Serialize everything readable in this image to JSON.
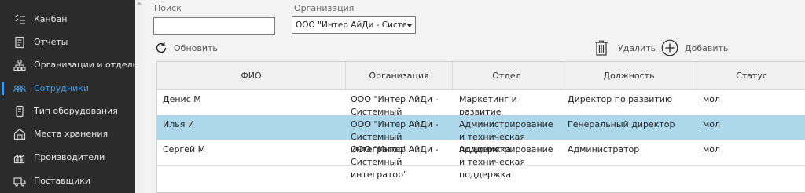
{
  "sidebar": {
    "items": [
      {
        "label": "Канбан",
        "icon": "kanban-icon",
        "active": false
      },
      {
        "label": "Отчеты",
        "icon": "reports-icon",
        "active": false
      },
      {
        "label": "Организации и отделы",
        "icon": "org-structure-icon",
        "active": false
      },
      {
        "label": "Сотрудники",
        "icon": "employees-icon",
        "active": true
      },
      {
        "label": "Тип оборудования",
        "icon": "equipment-type-icon",
        "active": false
      },
      {
        "label": "Места хранения",
        "icon": "storage-icon",
        "active": false
      },
      {
        "label": "Производители",
        "icon": "manufacturers-icon",
        "active": false
      },
      {
        "label": "Поставщики",
        "icon": "suppliers-icon",
        "active": false
      }
    ],
    "accent_color": "#3d9be9"
  },
  "filters": {
    "search_label": "Поиск",
    "search_value": "",
    "org_label": "Организация",
    "org_selected": "ООО \"Интер АйДи - Системный интегратор\""
  },
  "toolbar": {
    "refresh_label": "Обновить",
    "delete_label": "Удалить",
    "add_label": "Добавить"
  },
  "grid": {
    "columns": [
      "ФИО",
      "Организация",
      "Отдел",
      "Должность",
      "Статус"
    ],
    "rows": [
      {
        "fio": "Денис М",
        "org": "ООО \"Интер АйДи - Системный интегратор\"",
        "dept": "Маркетинг и развитие",
        "position": "Директор по развитию",
        "status": "мол",
        "selected": false
      },
      {
        "fio": "Илья И",
        "org": "ООО \"Интер АйДи - Системный интегратор\"",
        "dept": "Администрирование и техническая поддержка",
        "position": "Генеральный директор",
        "status": "мол",
        "selected": true
      },
      {
        "fio": "Сергей М",
        "org": "ООО \"Интер АйДи - Системный интегратор\"",
        "dept": "Администрирование и техническая поддержка",
        "position": "Администратор",
        "status": "мол",
        "selected": false
      }
    ]
  }
}
